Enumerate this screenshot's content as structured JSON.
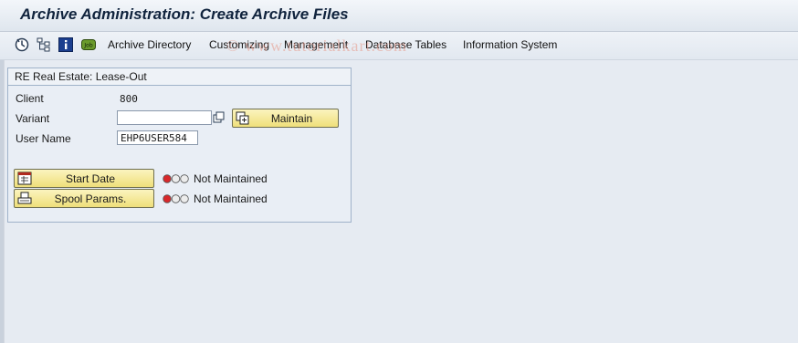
{
  "window": {
    "title": "Archive Administration: Create Archive Files"
  },
  "toolbar": {
    "icons": [
      "execute-icon",
      "hierarchy-icon",
      "info-icon",
      "job-icon"
    ],
    "job_icon_text": "Job",
    "menu": [
      "Archive Directory",
      "Customizing",
      "Management",
      "Database Tables",
      "Information System"
    ]
  },
  "watermark": "© www.tutorialkart.com",
  "group": {
    "title": "RE Real Estate: Lease-Out",
    "client_label": "Client",
    "client_value": "800",
    "variant_label": "Variant",
    "variant_value": "",
    "user_label": "User Name",
    "user_value": "EHP6USER584",
    "maintain_button": "Maintain",
    "start_date_button": "Start Date",
    "start_date_status": "Not Maintained",
    "spool_button": "Spool Params.",
    "spool_status": "Not Maintained"
  },
  "colors": {
    "light_red": "#d8282b",
    "light_off": "#e6e6e6",
    "button_yellow": "#f3e48e",
    "title_text": "#10233d"
  }
}
